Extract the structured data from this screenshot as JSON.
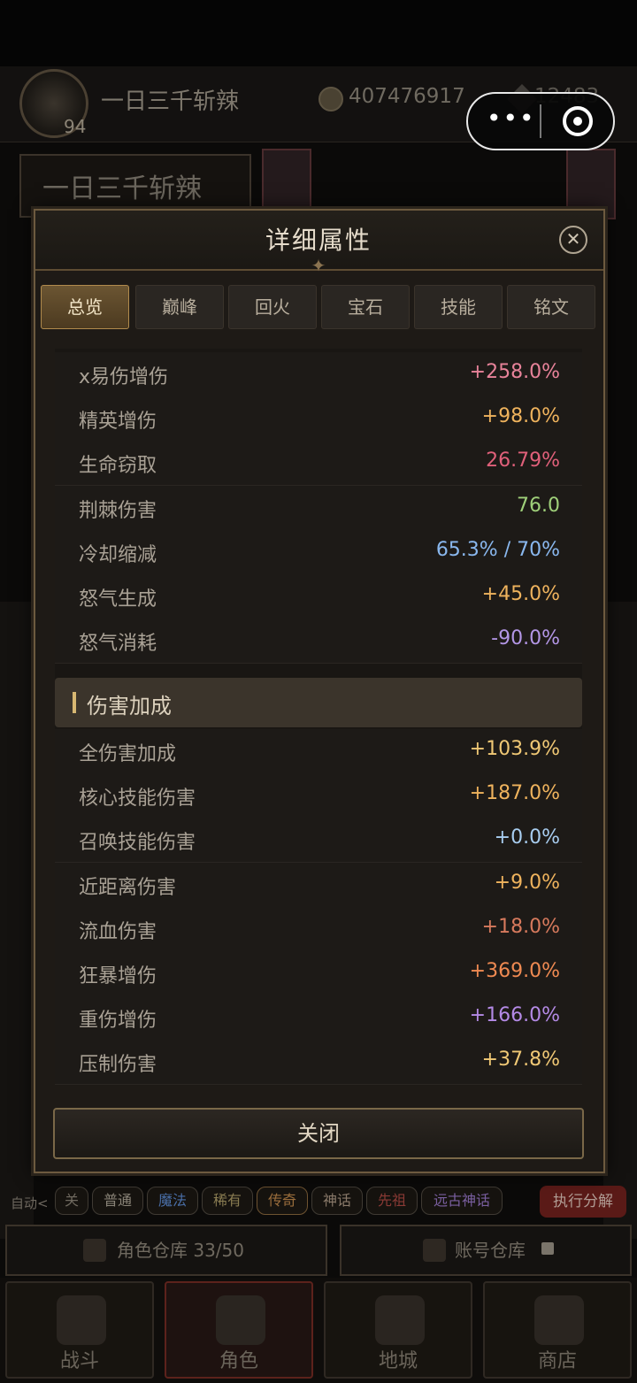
{
  "background": {
    "player_name": "一日三千斩辣",
    "player_level": "94",
    "gold": "407476917",
    "gems": "12483",
    "name_plate": "一日三千斩辣",
    "auto_label": "自动<",
    "filter_chips": [
      "关",
      "普通",
      "魔法",
      "稀有",
      "传奇",
      "神话",
      "先祖",
      "远古神话"
    ],
    "execute_button": "执行分解",
    "char_storage": "角色仓库 33/50",
    "account_storage": "账号仓库",
    "nav": [
      "战斗",
      "角色",
      "地城",
      "商店"
    ]
  },
  "miniprogram": {
    "more_icon": "more-dots-icon",
    "close_icon": "target-icon"
  },
  "modal": {
    "title": "详细属性",
    "tabs": [
      "总览",
      "巅峰",
      "回火",
      "宝石",
      "技能",
      "铭文"
    ],
    "active_tab": "总览",
    "rows_top": [
      {
        "label": "x易伤增伤",
        "value": "+258.0%",
        "color": "#e8839a"
      },
      {
        "label": "精英增伤",
        "value": "+98.0%",
        "color": "#efb35d"
      },
      {
        "label": "生命窃取",
        "value": "26.79%",
        "color": "#e0607a"
      },
      {
        "label": "荆棘伤害",
        "value": "76.0",
        "color": "#9fd07a"
      },
      {
        "label": "冷却缩减",
        "value": "65.3% / 70%",
        "color": "#8ab8ef"
      },
      {
        "label": "怒气生成",
        "value": "+45.0%",
        "color": "#efb35d"
      },
      {
        "label": "怒气消耗",
        "value": "-90.0%",
        "color": "#b396e6"
      }
    ],
    "section_title": "伤害加成",
    "rows_damage": [
      {
        "label": "全伤害加成",
        "value": "+103.9%",
        "color": "#f0c875"
      },
      {
        "label": "核心技能伤害",
        "value": "+187.0%",
        "color": "#efb35d"
      },
      {
        "label": "召唤技能伤害",
        "value": "+0.0%",
        "color": "#a8cdf0"
      },
      {
        "label": "近距离伤害",
        "value": "+9.0%",
        "color": "#efb35d"
      },
      {
        "label": "流血伤害",
        "value": "+18.0%",
        "color": "#d77a5d"
      },
      {
        "label": "狂暴增伤",
        "value": "+369.0%",
        "color": "#ef8a52"
      },
      {
        "label": "重伤增伤",
        "value": "+166.0%",
        "color": "#b48ae6"
      },
      {
        "label": "压制伤害",
        "value": "+37.8%",
        "color": "#f0c875"
      }
    ],
    "close_button": "关闭"
  }
}
